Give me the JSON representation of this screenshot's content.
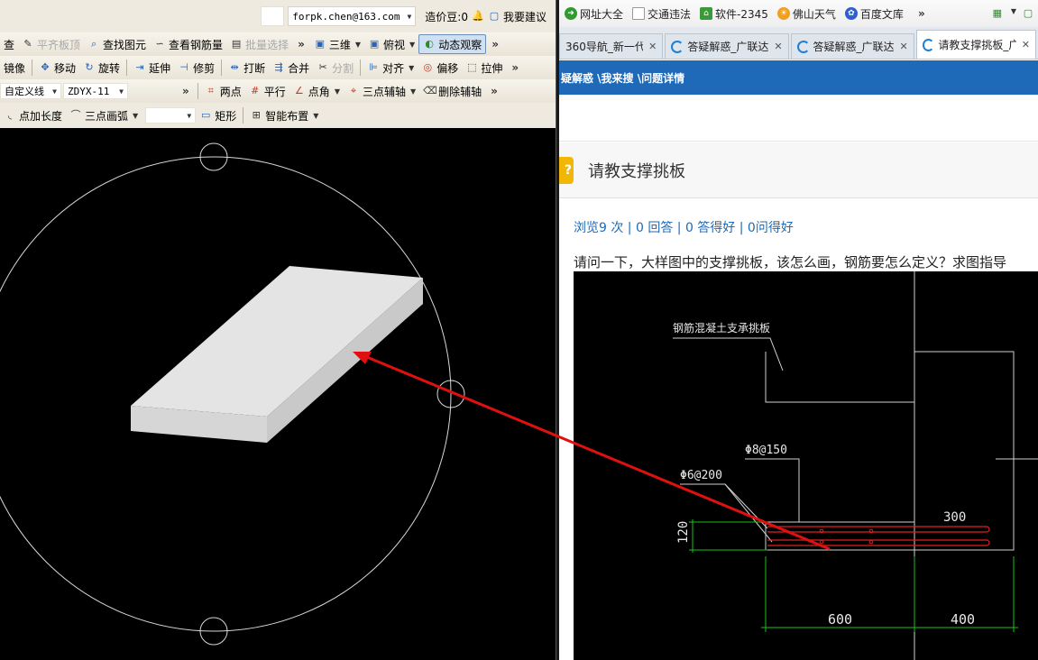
{
  "cad": {
    "top_bar": {
      "email": "forpk.chen@163.com",
      "points_label": "造价豆:0",
      "suggest_label": "我要建议"
    },
    "toolbar1": {
      "cut1": "查",
      "flat_top": "平齐板顶",
      "find_element": "查找图元",
      "view_rebar": "查看钢筋量",
      "batch_select": "批量选择",
      "view3d": "三维",
      "topview": "俯视",
      "dynamic_view": "动态观察"
    },
    "toolbar2": {
      "mirror": "镜像",
      "move": "移动",
      "rotate": "旋转",
      "extend": "延伸",
      "trim": "修剪",
      "break": "打断",
      "merge": "合并",
      "split": "分割",
      "align": "对齐",
      "offset": "偏移",
      "stretch": "拉伸"
    },
    "toolbar3": {
      "custom_line": "自定义线",
      "axis_code": "ZDYX-11",
      "two_points": "两点",
      "parallel": "平行",
      "point_angle": "点角",
      "three_point_aux": "三点辅轴",
      "delete_aux": "删除辅轴"
    },
    "toolbar4": {
      "point_length": "点加长度",
      "three_point_arc": "三点画弧",
      "rectangle": "矩形",
      "smart_layout": "智能布置"
    }
  },
  "browser": {
    "bookmarks": [
      "网址大全",
      "交通违法",
      "软件-2345",
      "佛山天气",
      "百度文库"
    ],
    "tabs": [
      {
        "label": "360导航_新一代",
        "active": false
      },
      {
        "label": "答疑解惑_广联达",
        "active": false
      },
      {
        "label": "答疑解惑_广联达",
        "active": false
      },
      {
        "label": "请教支撑挑板_广",
        "active": true
      }
    ],
    "breadcrumb": "疑解惑 \\我来搜 \\问题详情",
    "question": {
      "title": "请教支撑挑板",
      "stats": "浏览9 次 | 0 回答 | 0 答得好 | 0问得好",
      "text": "请问一下，大样图中的支撑挑板，该怎么画，钢筋要怎么定义？求图指导"
    },
    "drawing": {
      "label_main": "钢筋混凝土支承挑板",
      "label_rebar1": "Φ8@150",
      "label_rebar2": "Φ6@200",
      "dim_thickness": "120",
      "dim_span_right": "300",
      "dim_a": "600",
      "dim_b": "400"
    }
  },
  "colors": {
    "arrow": "#e01010",
    "crumb_bg": "#1e6ab8",
    "cad_bg": "#000000",
    "cad_line": "#d8d8d8",
    "slab_top": "#e3e3e3",
    "dim_green": "#19c219",
    "rebar_red": "#e02020"
  }
}
